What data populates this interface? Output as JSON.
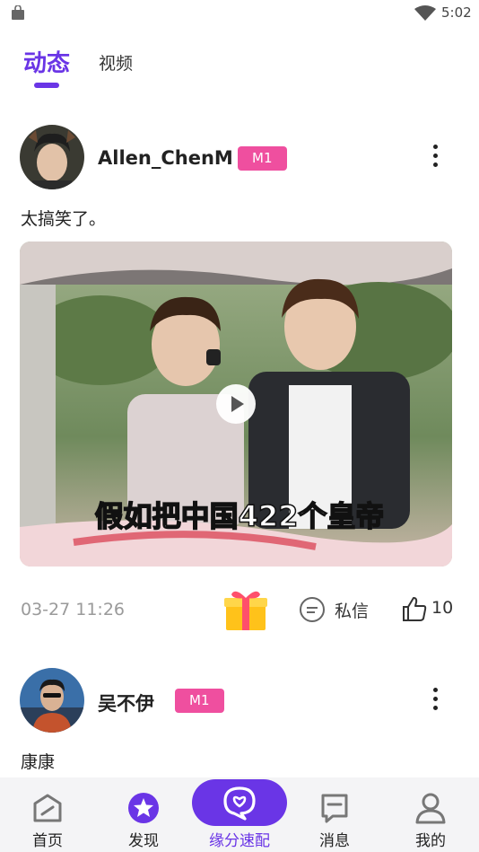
{
  "status_bar": {
    "time": "5:02",
    "icons": [
      "bag-icon",
      "wifi-icon"
    ]
  },
  "tabs": [
    {
      "label": "动态",
      "active": true
    },
    {
      "label": "视频",
      "active": false
    }
  ],
  "colors": {
    "accent": "#6a35e6",
    "badge": "#ef4f9f",
    "muted_text": "#9a9a9a",
    "nav_background": "#f4f4f6"
  },
  "posts": [
    {
      "username": "Allen_ChenM",
      "level": "M1",
      "text": "太搞笑了。",
      "video_caption": "假如把中国422个皇帝",
      "time": "03-27 11:26",
      "message_label": "私信",
      "like_count": "10"
    },
    {
      "username": "吴不伊",
      "level": "M1",
      "text": "康康"
    }
  ],
  "bottom_nav": [
    {
      "label": "首页",
      "icon": "home-icon",
      "active": false
    },
    {
      "label": "发现",
      "icon": "discover-star-icon",
      "active": false
    },
    {
      "label": "缘分速配",
      "icon": "match-chat-icon",
      "active": true
    },
    {
      "label": "消息",
      "icon": "message-icon",
      "active": false
    },
    {
      "label": "我的",
      "icon": "profile-icon",
      "active": false
    }
  ]
}
